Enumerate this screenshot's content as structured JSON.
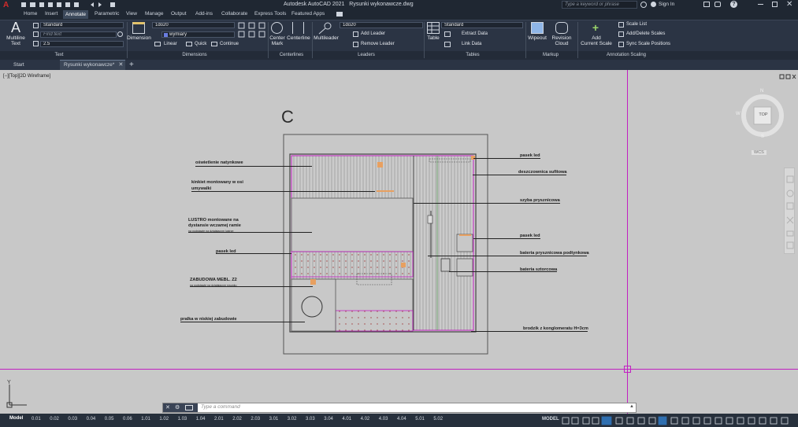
{
  "app": {
    "title": "Autodesk AutoCAD 2021",
    "file": "Rysunki wykonawcze.dwg"
  },
  "search": {
    "placeholder": "Type a keyword or phrase"
  },
  "account": {
    "sign_in": "Sign In"
  },
  "menu": {
    "items": [
      "Home",
      "Insert",
      "Annotate",
      "Parametric",
      "View",
      "Manage",
      "Output",
      "Add-ins",
      "Collaborate",
      "Express Tools",
      "Featured Apps"
    ],
    "active": "Annotate"
  },
  "ribbon": {
    "text": {
      "multiline": "Multiline",
      "text": "Text",
      "style": "Standard",
      "find": "Find text",
      "height": "2.5"
    },
    "dimensions": {
      "dimension": "Dimension",
      "style": "1do20",
      "layer": "wymiary",
      "linear": "Linear",
      "quick": "Quick",
      "continue": "Continue"
    },
    "centerlines": {
      "center_mark": "Center",
      "center_mark2": "Mark",
      "centerline": "Centerline"
    },
    "leaders": {
      "multileader": "Multileader",
      "style": "1do20",
      "add": "Add Leader",
      "remove": "Remove Leader"
    },
    "tables": {
      "table": "Table",
      "style": "Standard",
      "extract": "Extract Data",
      "link": "Link Data"
    },
    "markup": {
      "wipeout": "Wipeout",
      "revision": "Revision",
      "revision2": "Cloud"
    },
    "scaling": {
      "add_scale": "Add",
      "add_scale2": "Current Scale",
      "scale_list": "Scale List",
      "add_delete": "Add/Delete Scales",
      "sync": "Sync Scale Positions"
    },
    "group_labels": {
      "text": "Text",
      "dimensions": "Dimensions",
      "centerlines": "Centerlines",
      "leaders": "Leaders",
      "tables": "Tables",
      "markup": "Markup",
      "scaling": "Annotation Scaling"
    }
  },
  "tabs": {
    "start": "Start",
    "drawing": "Rysunki wykonawcze*"
  },
  "viewport": {
    "label": "[−][Top][2D Wireframe]"
  },
  "viewcube": {
    "top": "TOP",
    "n": "N",
    "s": "S",
    "w": "W",
    "wcs": "WCS"
  },
  "drawing": {
    "title": "C",
    "labels_left": [
      "oświetlenie natynkowe",
      "kinkiet montowany w osi",
      "umywalki",
      "LUSTRO montowane na",
      "dystansie wczamej ramie",
      "na podstawie na działajacym lustrze",
      "pasek led",
      "ZABUDOWA MEBL. Z2",
      "na podstawie na działajacym rysunku",
      "pralka w niskiej zabudowie"
    ],
    "labels_right": [
      "pasek led",
      "deszczownica sufitowa",
      "szyba prysznicowa",
      "pasek led",
      "bateria prysznicowa podtynkowa",
      "bateria sztorcowa",
      "brodzik z konglomeratu H=3cm"
    ]
  },
  "command": {
    "placeholder": "Type a command"
  },
  "status": {
    "model": "Model",
    "layouts": [
      "0.01",
      "0.02",
      "0.03",
      "0.04",
      "0.05",
      "0.06",
      "1.01",
      "1.02",
      "1.03",
      "1.04",
      "2.01",
      "2.02",
      "2.03",
      "3.01",
      "3.02",
      "3.03",
      "3.04",
      "4.01",
      "4.02",
      "4.03",
      "4.04",
      "5.01",
      "5.02"
    ],
    "mode": "MODEL"
  },
  "colors": {
    "accent_red": "#c8102e",
    "magenta": "#c21fc2",
    "orange": "#e8a060",
    "ui_dark": "#2b3444"
  }
}
